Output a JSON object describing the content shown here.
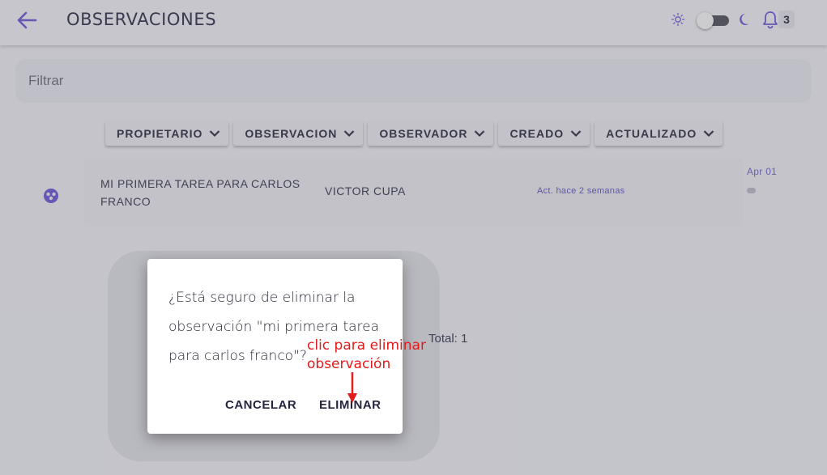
{
  "header": {
    "title": "OBSERVACIONES",
    "notifications_count": "3"
  },
  "filter": {
    "placeholder": "Filtrar"
  },
  "sort_buttons": [
    {
      "label": "PROPIETARIO"
    },
    {
      "label": "OBSERVACION"
    },
    {
      "label": "OBSERVADOR"
    },
    {
      "label": "CREADO"
    },
    {
      "label": "ACTUALIZADO"
    }
  ],
  "observations": [
    {
      "title": "MI PRIMERA TAREA PARA CARLOS FRANCO",
      "observer": "VICTOR CUPA",
      "updated": "Act. hace 2 semanas",
      "date": "Apr 01"
    }
  ],
  "total_label": "Total: 1",
  "dialog": {
    "message": "¿Está seguro de eliminar la observación \"mi primera tarea para carlos franco\"?",
    "cancel_label": "CANCELAR",
    "delete_label": "ELIMINAR"
  },
  "annotation": {
    "line1": "clic para eliminar",
    "line2": "observación"
  },
  "colors": {
    "accent": "#6b4fd8",
    "annotation": "#e21b1b"
  }
}
